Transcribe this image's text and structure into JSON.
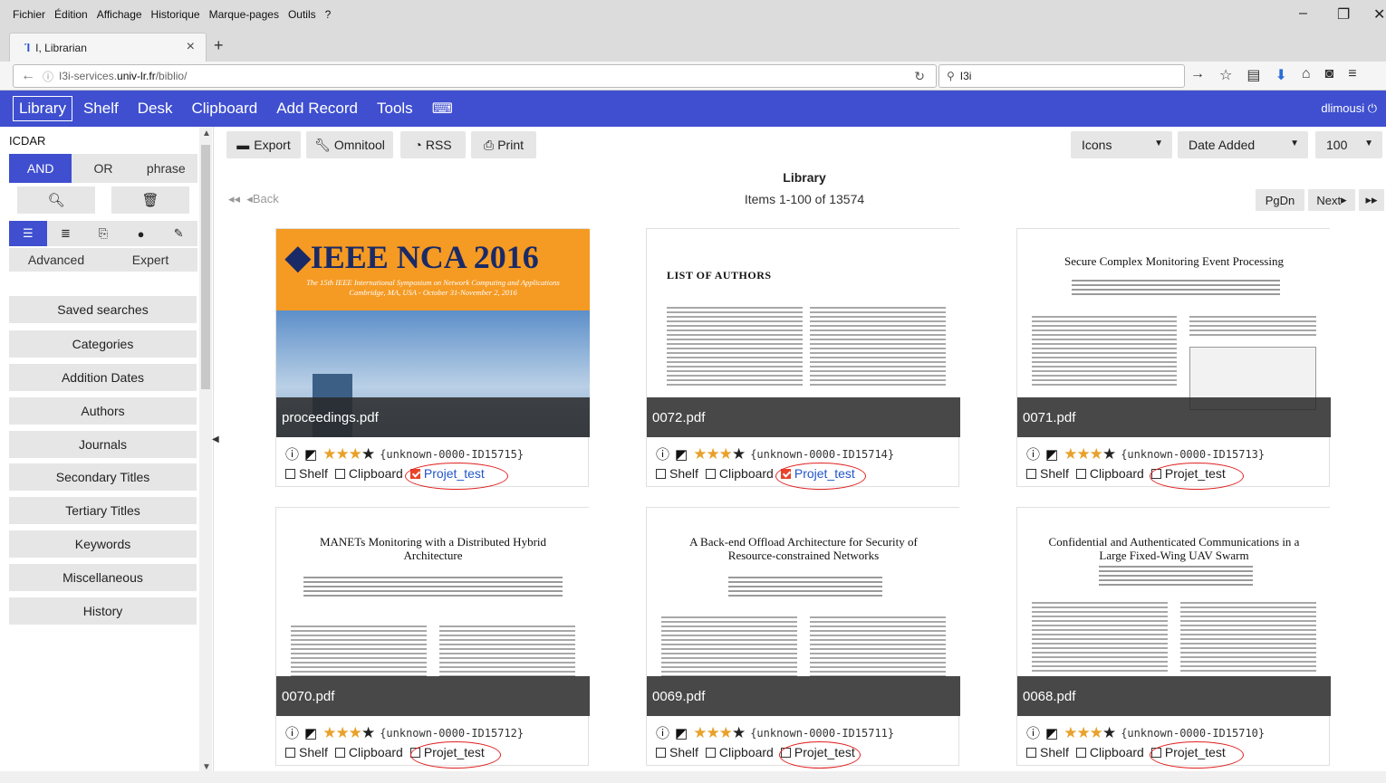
{
  "browser": {
    "menu": [
      "Fichier",
      "Édition",
      "Affichage",
      "Historique",
      "Marque-pages",
      "Outils",
      "?"
    ],
    "tab_title": "I, Librarian",
    "url_prefix": "I3i-services.",
    "url_domain": "univ-lr.fr",
    "url_path": "/biblio/",
    "search_value": "I3i"
  },
  "app": {
    "nav": [
      "Library",
      "Shelf",
      "Desk",
      "Clipboard",
      "Add Record",
      "Tools"
    ],
    "user": "dlimousi"
  },
  "sidebar": {
    "query": "ICDAR",
    "bool_ops": [
      "AND",
      "OR",
      "phrase"
    ],
    "adv": [
      "Advanced",
      "Expert"
    ],
    "buttons": [
      "Saved searches",
      "Categories",
      "Addition Dates",
      "Authors",
      "Journals",
      "Secondary Titles",
      "Tertiary Titles",
      "Keywords",
      "Miscellaneous",
      "History"
    ]
  },
  "toolbar": {
    "export": "Export",
    "omnitool": "Omnitool",
    "rss": "RSS",
    "print": "Print",
    "view_select": "Icons",
    "sort_select": "Date Added",
    "count_select": "100"
  },
  "library": {
    "title": "Library",
    "items_text": "Items 1-100 of 13574",
    "back": "Back",
    "pgdn": "PgDn",
    "next": "Next"
  },
  "cards": [
    {
      "file": "proceedings.pdf",
      "key": "{unknown-0000-ID15715}",
      "shelf": "Shelf",
      "clipboard": "Clipboard",
      "project": "Projet_test",
      "project_checked": true,
      "stars": 3
    },
    {
      "file": "0072.pdf",
      "key": "{unknown-0000-ID15714}",
      "shelf": "Shelf",
      "clipboard": "Clipboard",
      "project": "Projet_test",
      "project_checked": true,
      "stars": 3
    },
    {
      "file": "0071.pdf",
      "key": "{unknown-0000-ID15713}",
      "shelf": "Shelf",
      "clipboard": "Clipboard",
      "project": "Projet_test",
      "project_checked": false,
      "stars": 3
    },
    {
      "file": "0070.pdf",
      "key": "{unknown-0000-ID15712}",
      "shelf": "Shelf",
      "clipboard": "Clipboard",
      "project": "Projet_test",
      "project_checked": false,
      "stars": 3
    },
    {
      "file": "0069.pdf",
      "key": "{unknown-0000-ID15711}",
      "shelf": "Shelf",
      "clipboard": "Clipboard",
      "project": "Projet_test",
      "project_checked": false,
      "stars": 3
    },
    {
      "file": "0068.pdf",
      "key": "{unknown-0000-ID15710}",
      "shelf": "Shelf",
      "clipboard": "Clipboard",
      "project": "Projet_test",
      "project_checked": false,
      "stars": 3
    }
  ],
  "thumbs": {
    "ieee_title": "IEEE NCA 2016",
    "ieee_sub1": "The 15th IEEE International Symposium on Network Computing and Applications",
    "ieee_sub2": "Cambridge, MA, USA - October 31-November 2, 2016",
    "loa": "LIST OF AUTHORS",
    "t71": "Secure Complex Monitoring Event Processing",
    "t70": "MANETs Monitoring with a Distributed Hybrid Architecture",
    "t69": "A Back-end Offload Architecture for Security of Resource-constrained Networks",
    "t68": "Confidential and Authenticated Communications in a Large Fixed-Wing UAV Swarm"
  },
  "colors": {
    "accent": "#3f4fd0",
    "annotation": "#e02020",
    "star": "#e8a12a"
  }
}
